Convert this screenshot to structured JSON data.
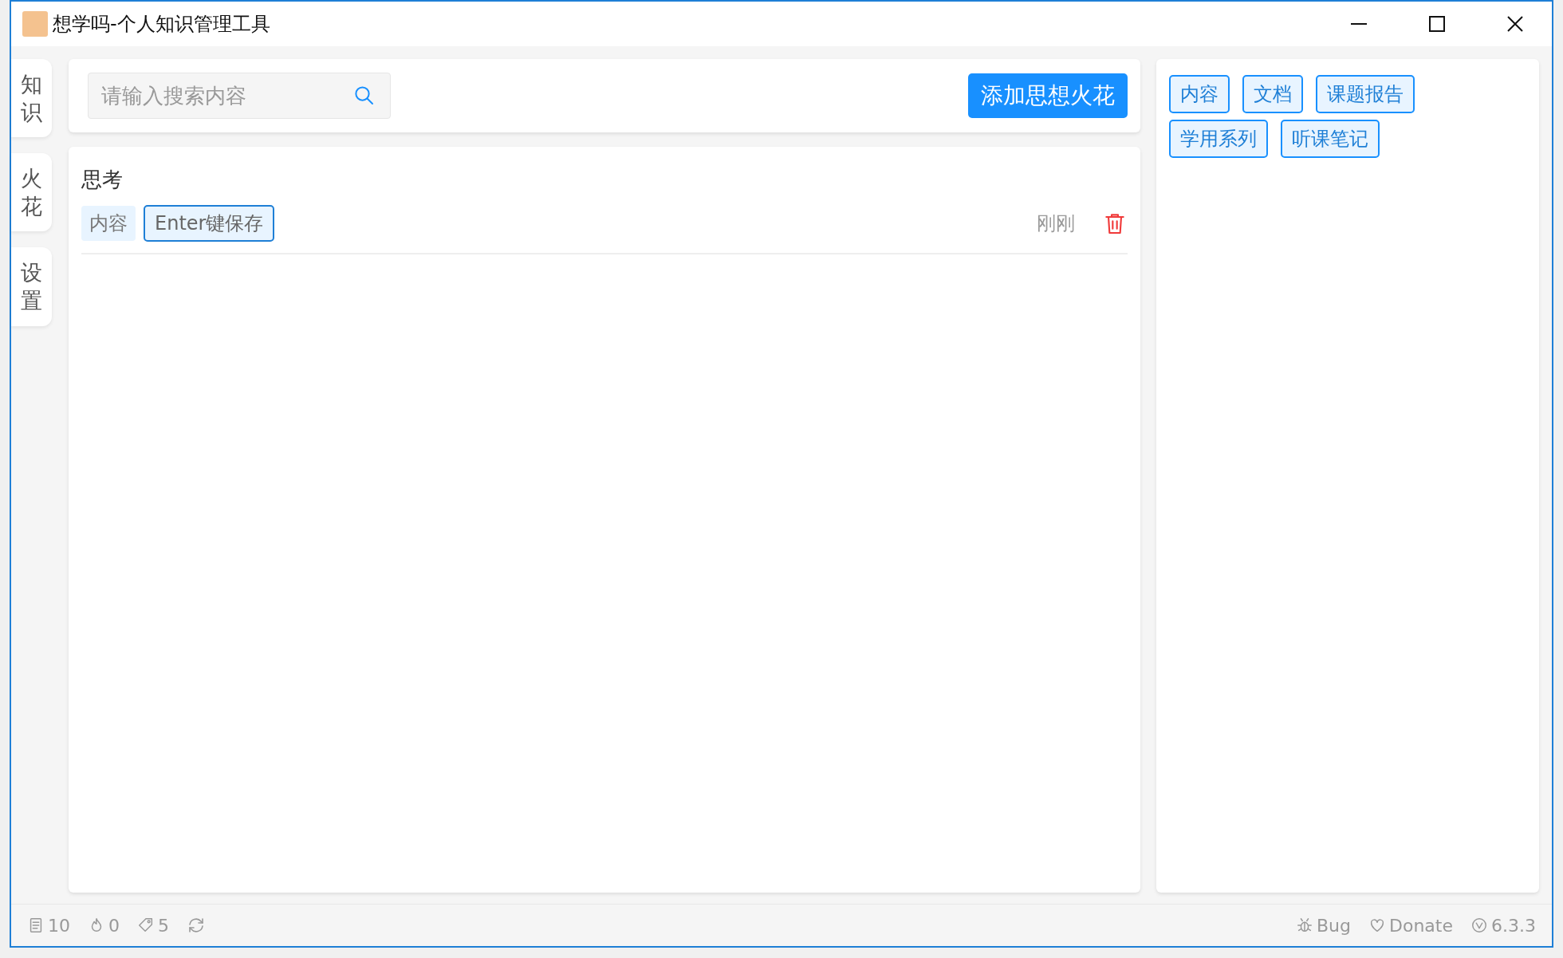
{
  "window": {
    "title": "想学吗-个人知识管理工具"
  },
  "sidebar": {
    "items": [
      {
        "label": "知识"
      },
      {
        "label": "火花"
      },
      {
        "label": "设置"
      }
    ]
  },
  "toolbar": {
    "search": {
      "placeholder": "请输入搜索内容"
    },
    "add_button": "添加思想火花"
  },
  "notes": [
    {
      "title": "思考",
      "tags": [
        {
          "kind": "tag",
          "label": "内容"
        },
        {
          "kind": "input",
          "label": "Enter键保存"
        }
      ],
      "time": "刚刚"
    }
  ],
  "tag_panel": {
    "tags": [
      "内容",
      "文档",
      "课题报告",
      "学用系列",
      "听课笔记"
    ]
  },
  "status_bar": {
    "left": [
      {
        "kind": "docs",
        "text": "10"
      },
      {
        "kind": "spark",
        "text": "0"
      },
      {
        "kind": "tags",
        "text": "5"
      },
      {
        "kind": "sync"
      }
    ],
    "right": [
      {
        "kind": "bug",
        "text": "Bug"
      },
      {
        "kind": "donate",
        "text": "Donate"
      },
      {
        "kind": "version",
        "text": "6.3.3"
      }
    ]
  }
}
